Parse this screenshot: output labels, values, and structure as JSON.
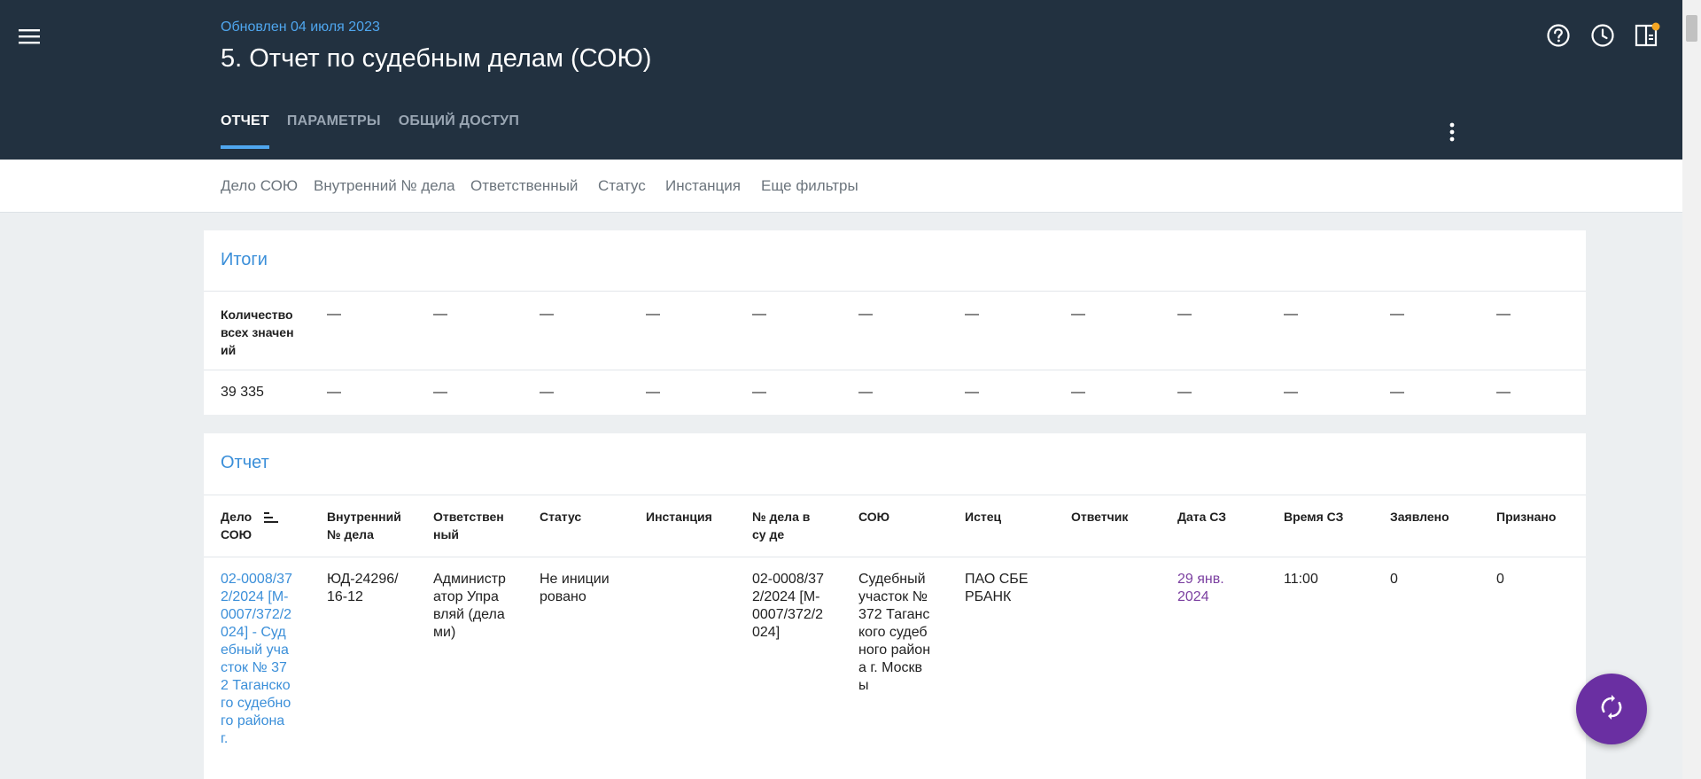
{
  "header": {
    "updated": "Обновлен 04 июля 2023",
    "title": "5. Отчет по судебным делам (СОЮ)",
    "tabs": [
      "ОТЧЕТ",
      "ПАРАМЕТРЫ",
      "ОБЩИЙ ДОСТУП"
    ],
    "active_tab": "ОТЧЕТ",
    "icons": [
      "menu-icon",
      "help-icon",
      "clock-icon",
      "panel-icon",
      "more-vert-icon"
    ],
    "accent": "#4fa6ee",
    "background": "#223140",
    "notification_dot": "#f5a623"
  },
  "filters": [
    "Дело СОЮ",
    "Внутренний № дела",
    "Ответственный",
    "Статус",
    "Инстанция",
    "Еще фильтры"
  ],
  "totals": {
    "title": "Итоги",
    "header_label": "Количество всех значен ий",
    "dash": "—",
    "count": "39 335"
  },
  "report": {
    "title": "Отчет",
    "columns": [
      "Дело СОЮ",
      "Внутренний № дела",
      "Ответствен ный",
      "Статус",
      "Инстанция",
      "№ дела в су де",
      "СОЮ",
      "Истец",
      "Ответчик",
      "Дата СЗ",
      "Время СЗ",
      "Заявлено",
      "Признано"
    ],
    "sort_icon": "sort-icon",
    "row": {
      "case": "02-0008/372/2024 [М-0007/372/2024] - Судебный участок № 372 Таганского судебного района г.",
      "internal": "ЮД-24296/16-12",
      "responsible": "Администратор Управляй (делами)",
      "status": "Не инициировано",
      "instance": "",
      "court_case": "02-0008/372/2024 [М-0007/372/2024]",
      "court": "Судебный участок № 372 Таганского судебного района г. Москвы",
      "plaintiff": "ПАО СБЕРБАНК",
      "defendant": "",
      "date": "29 янв. 2024",
      "time": "11:00",
      "claimed": "0",
      "admitted": "0"
    }
  },
  "fab": {
    "icon": "refresh-icon",
    "color": "#6a2fa2"
  }
}
